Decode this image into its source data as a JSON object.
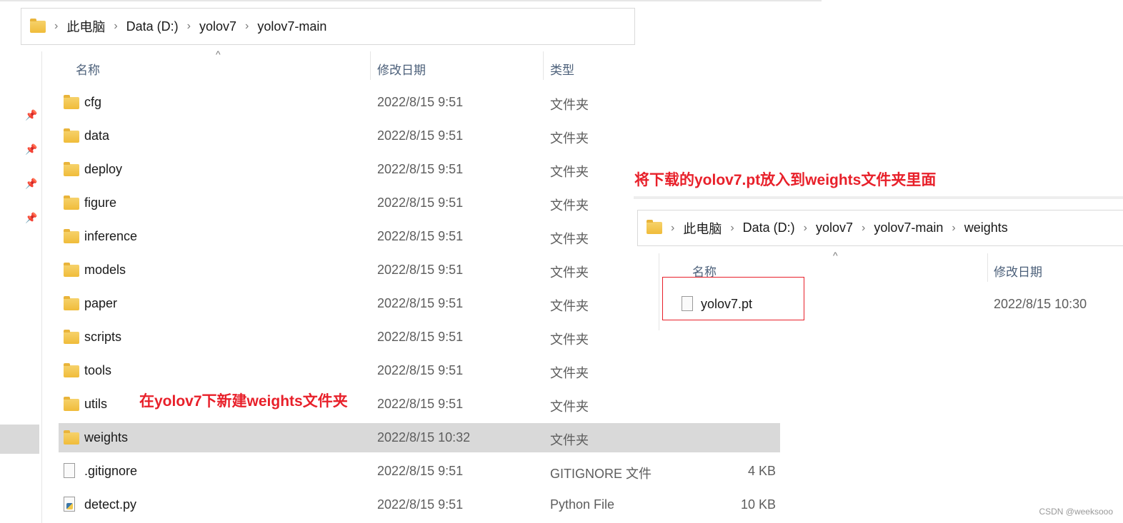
{
  "left_window": {
    "breadcrumb": [
      "此电脑",
      "Data (D:)",
      "yolov7",
      "yolov7-main"
    ],
    "columns": {
      "name": "名称",
      "date": "修改日期",
      "type": "类型"
    },
    "rows": [
      {
        "name": "cfg",
        "date": "2022/8/15 9:51",
        "type": "文件夹",
        "size": "",
        "icon": "folder-icon"
      },
      {
        "name": "data",
        "date": "2022/8/15 9:51",
        "type": "文件夹",
        "size": "",
        "icon": "folder-icon"
      },
      {
        "name": "deploy",
        "date": "2022/8/15 9:51",
        "type": "文件夹",
        "size": "",
        "icon": "folder-icon"
      },
      {
        "name": "figure",
        "date": "2022/8/15 9:51",
        "type": "文件夹",
        "size": "",
        "icon": "folder-icon"
      },
      {
        "name": "inference",
        "date": "2022/8/15 9:51",
        "type": "文件夹",
        "size": "",
        "icon": "folder-icon"
      },
      {
        "name": "models",
        "date": "2022/8/15 9:51",
        "type": "文件夹",
        "size": "",
        "icon": "folder-icon"
      },
      {
        "name": "paper",
        "date": "2022/8/15 9:51",
        "type": "文件夹",
        "size": "",
        "icon": "folder-icon"
      },
      {
        "name": "scripts",
        "date": "2022/8/15 9:51",
        "type": "文件夹",
        "size": "",
        "icon": "folder-icon"
      },
      {
        "name": "tools",
        "date": "2022/8/15 9:51",
        "type": "文件夹",
        "size": "",
        "icon": "folder-icon"
      },
      {
        "name": "utils",
        "date": "2022/8/15 9:51",
        "type": "文件夹",
        "size": "",
        "icon": "folder-icon"
      },
      {
        "name": "weights",
        "date": "2022/8/15 10:32",
        "type": "文件夹",
        "size": "",
        "icon": "folder-icon",
        "selected": true
      },
      {
        "name": ".gitignore",
        "date": "2022/8/15 9:51",
        "type": "GITIGNORE 文件",
        "size": "4 KB",
        "icon": "file-icon"
      },
      {
        "name": "detect.py",
        "date": "2022/8/15 9:51",
        "type": "Python File",
        "size": "10 KB",
        "icon": "python-file-icon"
      }
    ]
  },
  "right_window": {
    "breadcrumb": [
      "此电脑",
      "Data (D:)",
      "yolov7",
      "yolov7-main",
      "weights"
    ],
    "columns": {
      "name": "名称",
      "date": "修改日期"
    },
    "rows": [
      {
        "name": "yolov7.pt",
        "date": "2022/8/15 10:30"
      }
    ]
  },
  "annotations": {
    "left": "在yolov7下新建weights文件夹",
    "right": "将下载的yolov7.pt放入到weights文件夹里面",
    "color": "#e8202a"
  },
  "watermark": "CSDN @weeksooo"
}
